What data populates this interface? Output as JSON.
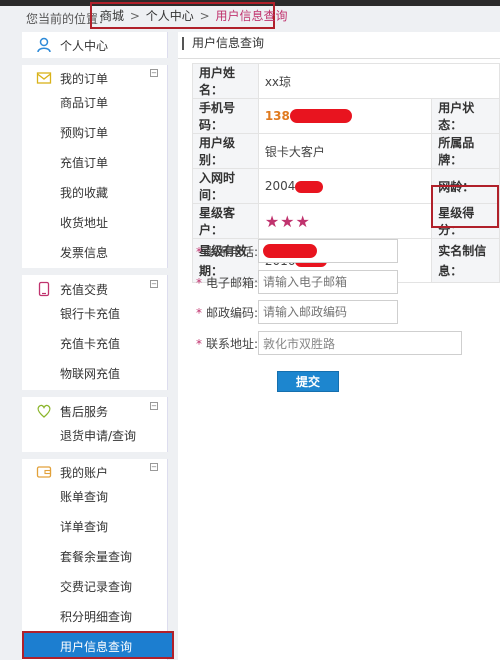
{
  "breadcrumb": {
    "label": "您当前的位置：",
    "items": [
      "商城",
      "个人中心",
      "用户信息查询"
    ],
    "separator": ">"
  },
  "sidebar": {
    "home": "个人中心",
    "groups": [
      {
        "title": "我的订单",
        "items": [
          "商品订单",
          "预购订单",
          "充值订单",
          "我的收藏",
          "收货地址",
          "发票信息"
        ]
      },
      {
        "title": "充值交费",
        "items": [
          "银行卡充值",
          "充值卡充值",
          "物联网充值"
        ]
      },
      {
        "title": "售后服务",
        "items": [
          "退货申请/查询"
        ]
      },
      {
        "title": "我的账户",
        "items": [
          "账单查询",
          "详单查询",
          "套餐余量查询",
          "交费记录查询",
          "积分明细查询",
          "用户信息查询"
        ]
      }
    ],
    "active": "用户信息查询"
  },
  "content": {
    "title": "用户信息查询",
    "fields": {
      "name_label": "用户姓名：",
      "name_value": "xx琼",
      "phone_label": "手机号码：",
      "phone_value": "138",
      "status_label": "用户状态：",
      "level_label": "用户级别：",
      "level_value": "银卡大客户",
      "brand_label": "所属品牌：",
      "join_label": "入网时间：",
      "join_value": "2004",
      "age_label": "网龄：",
      "star_label": "星级客户：",
      "star_rating": 3,
      "star_text": "★★★",
      "score_label": "星级得分：",
      "valid_label": "星级有效期：",
      "valid_value": "2016",
      "realname_label": "实名制信息："
    },
    "form": {
      "contact_phone_label": "联系电话:",
      "email_label": "电子邮箱:",
      "email_placeholder": "请输入电子邮箱",
      "zip_label": "邮政编码:",
      "zip_placeholder": "请输入邮政编码",
      "address_label": "联系地址:",
      "address_value": "敦化市双胜路",
      "required_mark": "*"
    },
    "submit_label": "提交"
  },
  "colors": {
    "accent": "#1c7ed0",
    "highlight_box": "#b0202a",
    "redaction": "#e8141f",
    "breadcrumb_current": "#c0336e"
  }
}
